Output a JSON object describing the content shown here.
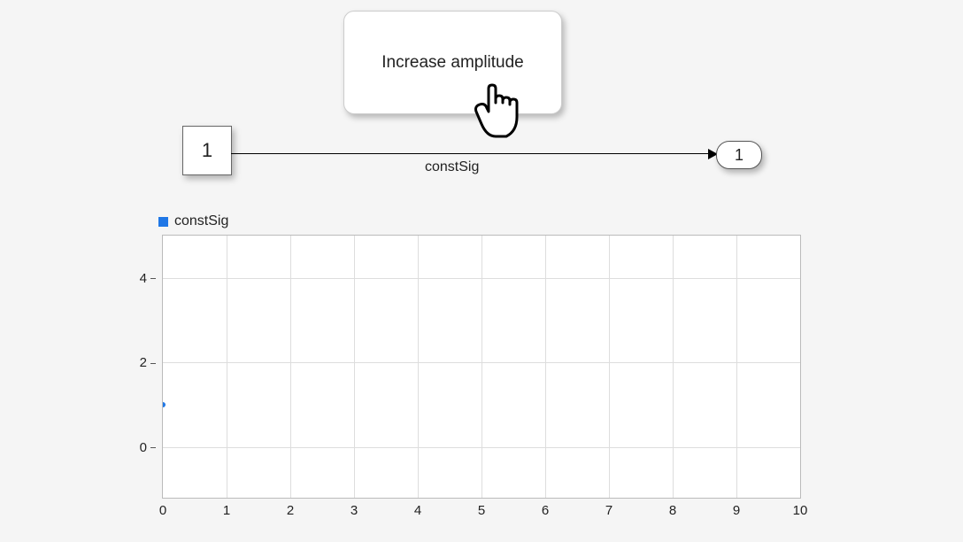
{
  "callout": {
    "label": "Increase amplitude"
  },
  "blocks": {
    "constant": {
      "label": "1"
    },
    "outport": {
      "label": "1"
    }
  },
  "signal": {
    "label": "constSig"
  },
  "legend": {
    "series_name": "constSig"
  },
  "chart_data": {
    "type": "scatter",
    "series": [
      {
        "name": "constSig",
        "x": [
          0
        ],
        "y": [
          1
        ],
        "color": "#1f77e6"
      }
    ],
    "x_ticks": [
      0,
      1,
      2,
      3,
      4,
      5,
      6,
      7,
      8,
      9,
      10
    ],
    "y_ticks": [
      0,
      2,
      4
    ],
    "xlim": [
      0,
      10
    ],
    "ylim": [
      -1.2,
      5
    ],
    "xlabel": "",
    "ylabel": "",
    "title": ""
  }
}
